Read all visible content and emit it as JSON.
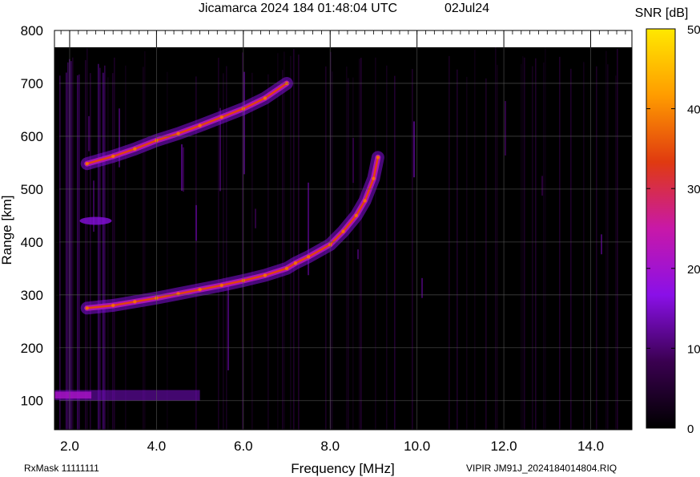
{
  "header": {
    "title": "Jicamarca 2024 184 01:48:04 UTC",
    "date": "02Jul24",
    "colorbar_title": "SNR [dB]"
  },
  "footer": {
    "rxmask": "RxMask 11111111",
    "file_label": "VIPIR  JM91J_2024184014804.RIQ"
  },
  "chart_data": {
    "type": "heatmap",
    "title": "Jicamarca 2024 184 01:48:04 UTC",
    "xlabel": "Frequency [MHz]",
    "ylabel": "Range [km]",
    "xlim": [
      1.65,
      14.95
    ],
    "ylim": [
      45,
      800
    ],
    "x_ticks": [
      "2.0",
      "4.0",
      "6.0",
      "8.0",
      "10.0",
      "12.0",
      "14.0"
    ],
    "y_ticks": [
      "100",
      "200",
      "300",
      "400",
      "500",
      "600",
      "700",
      "800"
    ],
    "grid": true,
    "colorbar": {
      "label": "SNR [dB]",
      "range": [
        0,
        50
      ],
      "ticks": [
        "0",
        "10",
        "20",
        "30",
        "40",
        "50"
      ],
      "colors": [
        "#000000",
        "#3a0050",
        "#8a10e8",
        "#c818a8",
        "#e03a10",
        "#ff9c00",
        "#ffe800"
      ]
    },
    "series": [
      {
        "x": [
          2.4,
          3.0,
          3.5,
          4.0,
          4.5,
          5.0,
          5.5,
          6.0,
          6.5,
          7.0,
          7.2,
          7.5,
          8.0,
          8.3,
          8.6,
          8.8,
          9.0,
          9.1
        ],
        "y": [
          275,
          280,
          287,
          294,
          302,
          310,
          318,
          327,
          337,
          350,
          360,
          372,
          395,
          420,
          450,
          478,
          520,
          560
        ]
      },
      {
        "x": [
          2.4,
          3.0,
          3.5,
          4.0,
          4.5,
          5.0,
          5.5,
          6.0,
          6.5,
          7.0
        ],
        "y": [
          548,
          562,
          576,
          592,
          605,
          620,
          636,
          652,
          672,
          700
        ]
      }
    ]
  }
}
